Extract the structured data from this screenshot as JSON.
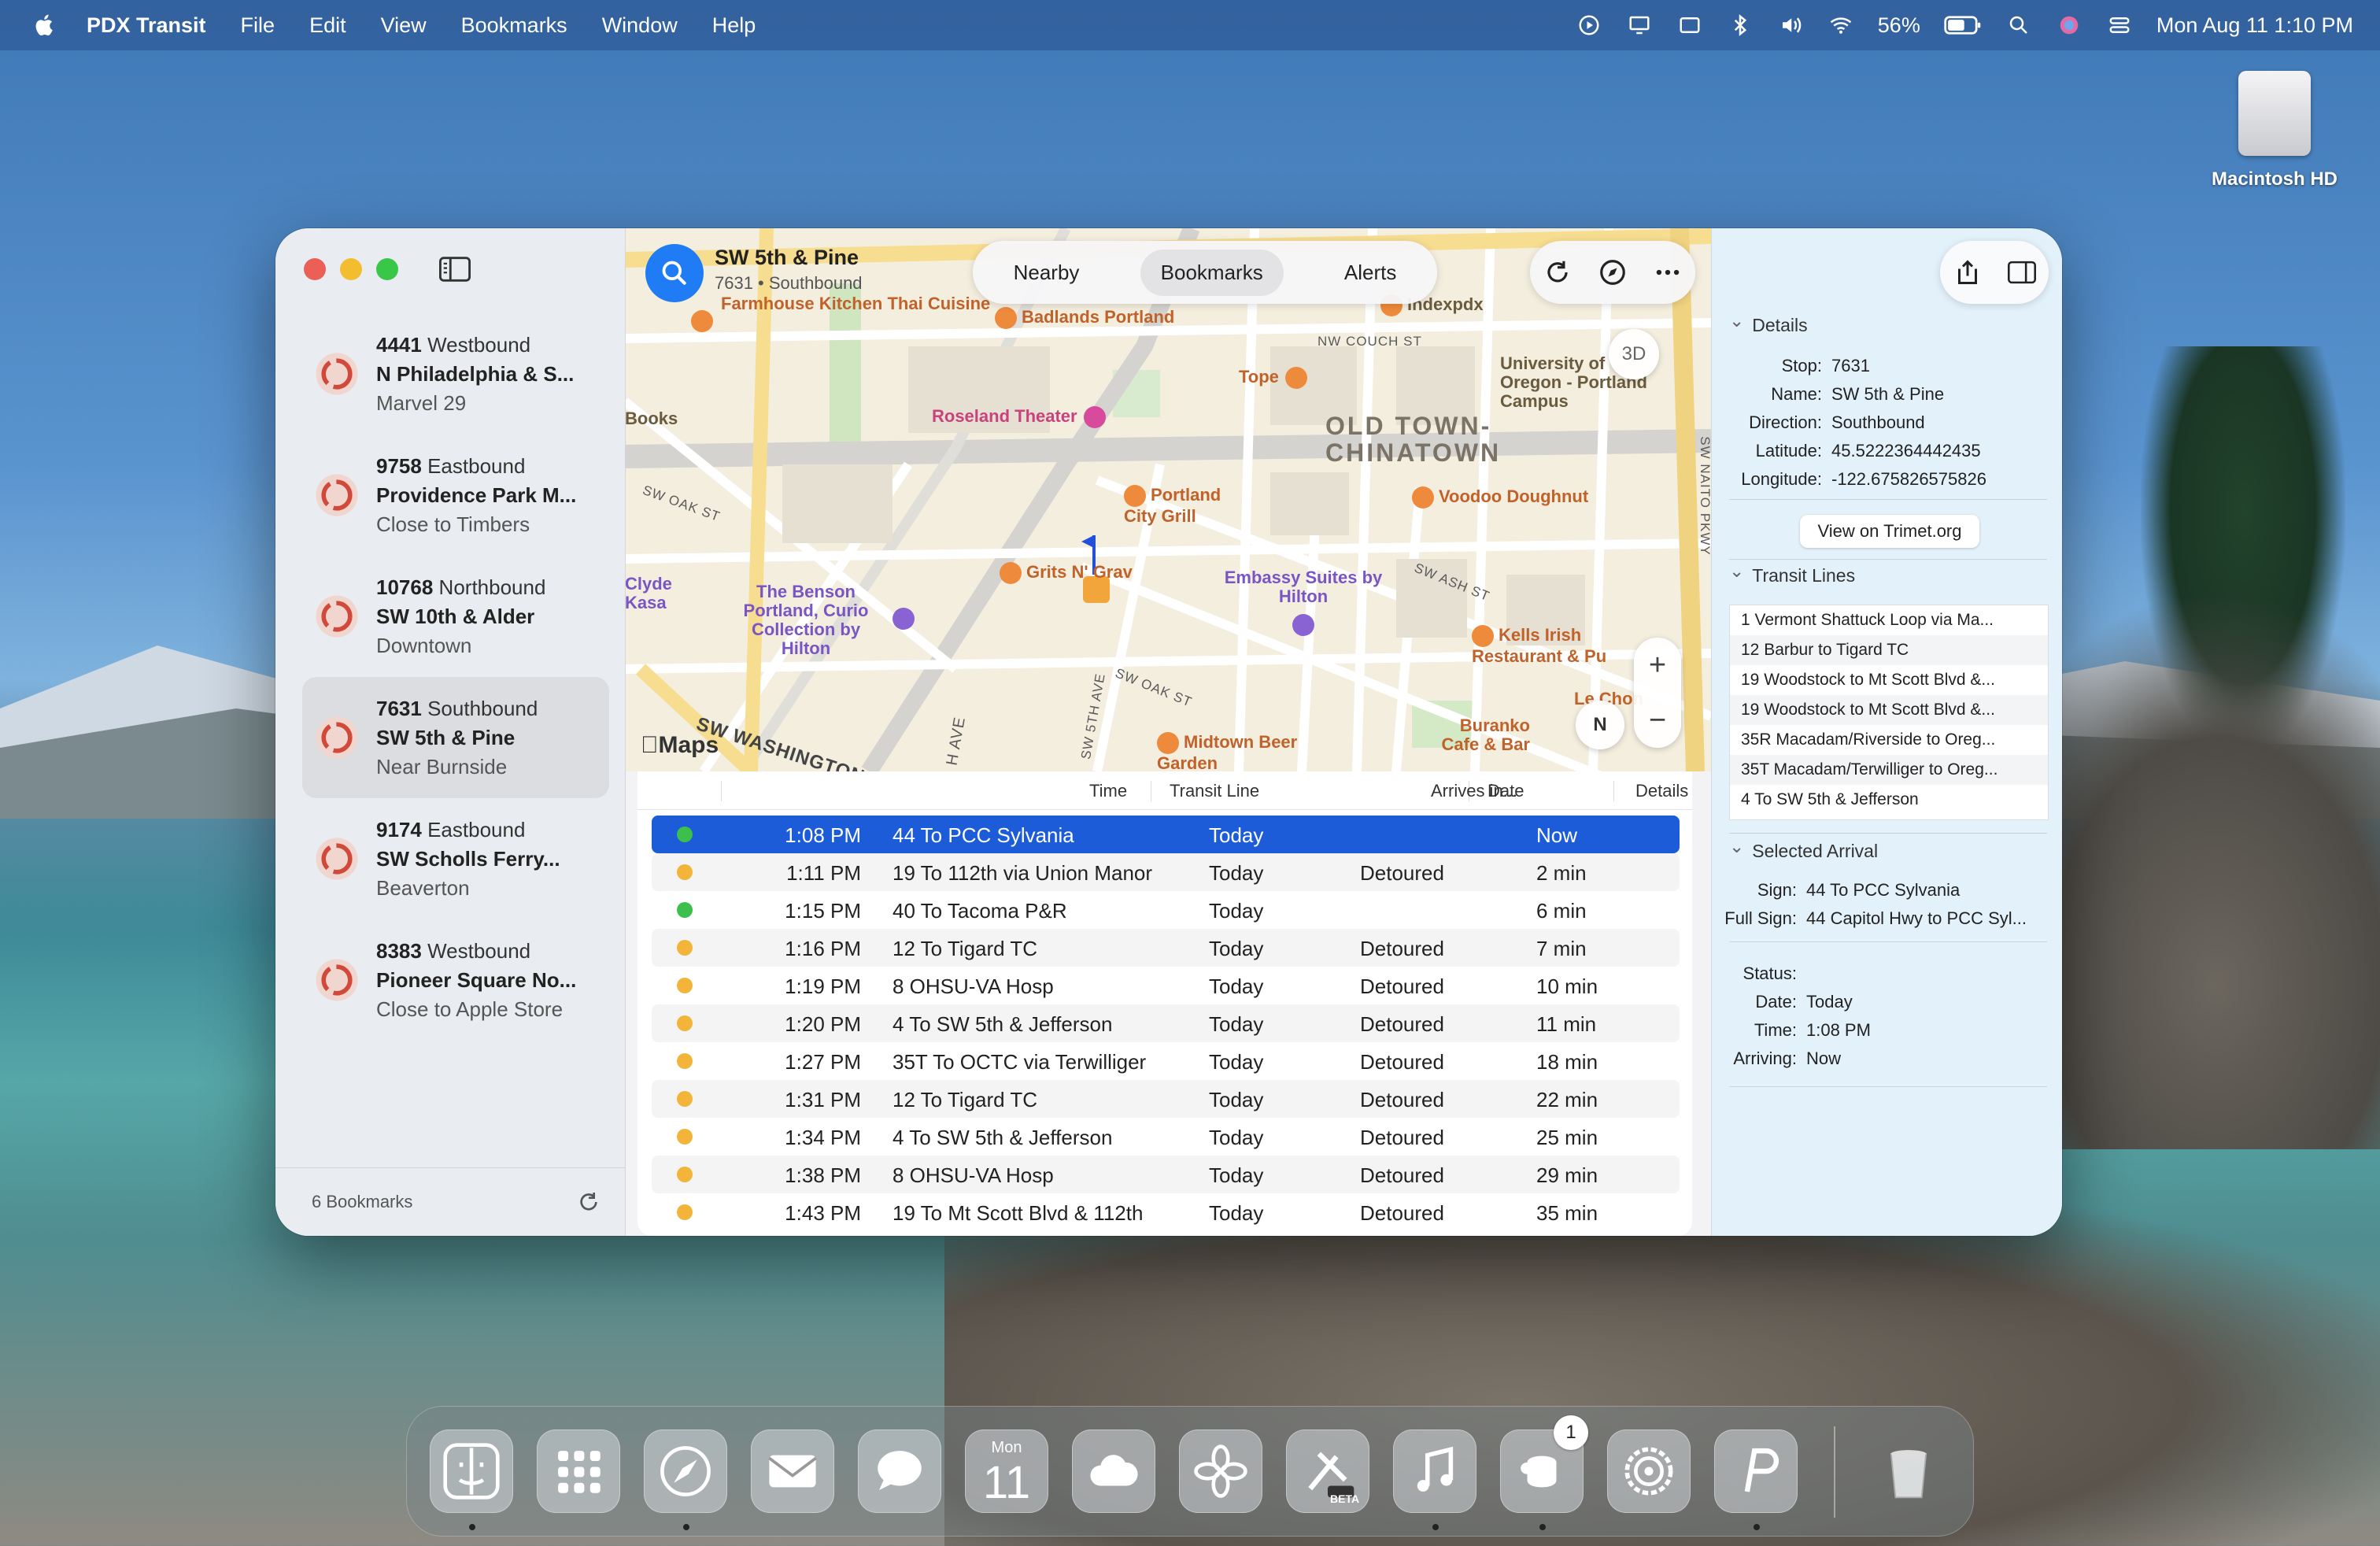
{
  "menubar": {
    "app_name": "PDX Transit",
    "menus": [
      "File",
      "Edit",
      "View",
      "Bookmarks",
      "Window",
      "Help"
    ],
    "battery": "56%",
    "clock": "Mon Aug 11  1:10 PM"
  },
  "desktop": {
    "drive_label": "Macintosh HD"
  },
  "sidebar": {
    "bookmarks": [
      {
        "id": "4441",
        "direction": "Westbound",
        "name": "N Philadelphia & S...",
        "note": "Marvel 29"
      },
      {
        "id": "9758",
        "direction": "Eastbound",
        "name": "Providence Park M...",
        "note": "Close to Timbers"
      },
      {
        "id": "10768",
        "direction": "Northbound",
        "name": "SW 10th & Alder",
        "note": "Downtown"
      },
      {
        "id": "7631",
        "direction": "Southbound",
        "name": "SW 5th & Pine",
        "note": "Near Burnside"
      },
      {
        "id": "9174",
        "direction": "Eastbound",
        "name": "SW Scholls Ferry...",
        "note": "Beaverton"
      },
      {
        "id": "8383",
        "direction": "Westbound",
        "name": "Pioneer Square No...",
        "note": "Close to Apple Store"
      }
    ],
    "footer_count": "6 Bookmarks"
  },
  "toolbar": {
    "stop_name": "SW 5th & Pine",
    "stop_sub": "7631 • Southbound",
    "segments": [
      "Nearby",
      "Bookmarks",
      "Alerts"
    ],
    "active_segment": "Bookmarks"
  },
  "map": {
    "btn_3d": "3D",
    "compass": "N",
    "zoom_in": "+",
    "zoom_out": "−",
    "maps_logo": "Maps",
    "district": [
      "OLD TOWN-",
      "CHINATOWN"
    ],
    "pois": [
      {
        "name": "Farmhouse Kitchen Thai Cuisine"
      },
      {
        "name": "Badlands Portland"
      },
      {
        "name": "Indexpdx"
      },
      {
        "name": "University of Oregon - Portland Campus"
      },
      {
        "name": "Tope"
      },
      {
        "name": "Books"
      },
      {
        "name": "Roseland Theater"
      },
      {
        "name": "Portland City Grill"
      },
      {
        "name": "Voodoo Doughnut"
      },
      {
        "name": "Clyde Kasa"
      },
      {
        "name": "The Benson Portland, Curio Collection by Hilton"
      },
      {
        "name": "Grits N' Grav"
      },
      {
        "name": "Embassy Suites by Hilton"
      },
      {
        "name": "Kells Irish Restaurant & Pu"
      },
      {
        "name": "Le Chon"
      },
      {
        "name": "Buranko Cafe & Bar"
      },
      {
        "name": "Midtown Beer Garden"
      }
    ],
    "streets": [
      "NW COUCH ST",
      "SW OAK ST",
      "SW ASH ST",
      "SW OAK ST",
      "SW 5TH AVE",
      "SW WASHINGTON",
      "H AVE",
      "SW NAITO PKWY"
    ]
  },
  "table": {
    "headers": [
      "Time",
      "Transit Line",
      "Date",
      "Details",
      "Arrives in..."
    ],
    "rows": [
      {
        "time": "1:08 PM",
        "line": "44 To PCC Sylvania",
        "date": "Today",
        "details": "",
        "arrives": "Now",
        "status": "green",
        "selected": true
      },
      {
        "time": "1:11 PM",
        "line": "19 To 112th via Union Manor",
        "date": "Today",
        "details": "Detoured",
        "arrives": "2 min",
        "status": "amber"
      },
      {
        "time": "1:15 PM",
        "line": "40 To Tacoma P&R",
        "date": "Today",
        "details": "",
        "arrives": "6 min",
        "status": "green"
      },
      {
        "time": "1:16 PM",
        "line": "12 To Tigard TC",
        "date": "Today",
        "details": "Detoured",
        "arrives": "7 min",
        "status": "amber"
      },
      {
        "time": "1:19 PM",
        "line": "8 OHSU-VA Hosp",
        "date": "Today",
        "details": "Detoured",
        "arrives": "10 min",
        "status": "amber"
      },
      {
        "time": "1:20 PM",
        "line": "4 To SW 5th & Jefferson",
        "date": "Today",
        "details": "Detoured",
        "arrives": "11 min",
        "status": "amber"
      },
      {
        "time": "1:27 PM",
        "line": "35T To OCTC via Terwilliger",
        "date": "Today",
        "details": "Detoured",
        "arrives": "18 min",
        "status": "amber"
      },
      {
        "time": "1:31 PM",
        "line": "12 To Tigard TC",
        "date": "Today",
        "details": "Detoured",
        "arrives": "22 min",
        "status": "amber"
      },
      {
        "time": "1:34 PM",
        "line": "4 To SW 5th & Jefferson",
        "date": "Today",
        "details": "Detoured",
        "arrives": "25 min",
        "status": "amber"
      },
      {
        "time": "1:38 PM",
        "line": "8 OHSU-VA Hosp",
        "date": "Today",
        "details": "Detoured",
        "arrives": "29 min",
        "status": "amber"
      },
      {
        "time": "1:43 PM",
        "line": "19 To Mt Scott Blvd & 112th",
        "date": "Today",
        "details": "Detoured",
        "arrives": "35 min",
        "status": "amber"
      }
    ]
  },
  "inspector": {
    "details_header": "Details",
    "details": [
      {
        "k": "Stop:",
        "v": "7631"
      },
      {
        "k": "Name:",
        "v": "SW 5th & Pine"
      },
      {
        "k": "Direction:",
        "v": "Southbound"
      },
      {
        "k": "Latitude:",
        "v": "45.5222364442435"
      },
      {
        "k": "Longitude:",
        "v": "-122.675826575826"
      }
    ],
    "trimet_button": "View on Trimet.org",
    "lines_header": "Transit Lines",
    "lines": [
      "1  Vermont Shattuck Loop via Ma...",
      "12  Barbur to Tigard TC",
      "19  Woodstock to Mt Scott Blvd &...",
      "19  Woodstock to Mt Scott Blvd &...",
      "35R  Macadam/Riverside to Oreg...",
      "35T  Macadam/Terwilliger to Oreg...",
      "4  To SW 5th & Jefferson"
    ],
    "arrival_header": "Selected Arrival",
    "arrival": [
      {
        "k": "Sign:",
        "v": "44 To PCC Sylvania"
      },
      {
        "k": "Full Sign:",
        "v": "44  Capitol Hwy to PCC Syl..."
      }
    ],
    "status": [
      {
        "k": "Status:",
        "v": ""
      },
      {
        "k": "Date:",
        "v": "Today"
      },
      {
        "k": "Time:",
        "v": "1:08 PM"
      },
      {
        "k": "Arriving:",
        "v": "Now"
      }
    ]
  },
  "dock": {
    "apps": [
      "finder-icon",
      "launchpad-icon",
      "safari-icon",
      "mail-icon",
      "messages-icon",
      "calendar-icon",
      "icloud-icon",
      "photos-icon",
      "xcode-beta-icon",
      "music-icon",
      "mastodon-icon",
      "system-settings-icon",
      "pockity-icon",
      "trash-icon"
    ],
    "calendar_month": "Mon",
    "calendar_day": "11",
    "badge": "1",
    "beta_label": "BETA"
  },
  "colors": {
    "accent": "#1f7cf4",
    "selected_row": "#1d5cd8",
    "status_green": "#3cbf4c",
    "status_amber": "#f2b53a",
    "poi_orange": "#ee8a3b"
  }
}
